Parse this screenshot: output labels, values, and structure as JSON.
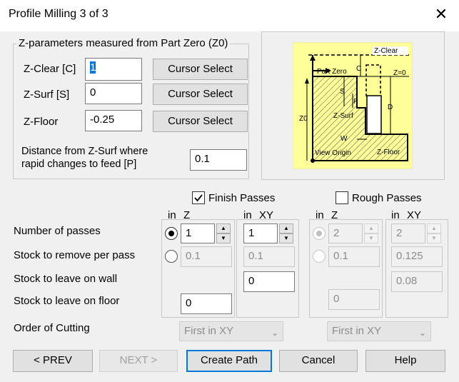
{
  "window": {
    "title": "Profile Milling 3 of 3",
    "close_glyph": "✕"
  },
  "zparams": {
    "group_label": "Z-parameters measured from Part Zero (Z0)",
    "zclear": {
      "label": "Z-Clear [C]",
      "value": "1"
    },
    "zsurf": {
      "label": "Z-Surf [S]",
      "value": "0"
    },
    "zfloor": {
      "label": "Z-Floor",
      "value": "-0.25"
    },
    "cursor_select_label": "Cursor Select",
    "distance": {
      "label_line1": "Distance from Z-Surf where",
      "label_line2": "rapid changes to feed [P]",
      "value": "0.1"
    }
  },
  "diagram": {
    "background": "#ffff99",
    "labels": {
      "zclear": "Z-Clear",
      "part_zero": "Part Zero",
      "c": "C",
      "z0eq": "Z=0",
      "s": "S",
      "p": "P",
      "d": "D",
      "z0": "Z0",
      "zsurf": "Z-Surf",
      "w": "W",
      "view_origin": "View Origin",
      "zfloor": "Z-Floor"
    }
  },
  "finish": {
    "checkbox_label": "Finish Passes",
    "checked": true,
    "col_z": {
      "unit": "in",
      "label": "Z"
    },
    "col_xy": {
      "unit": "in",
      "label": "XY"
    },
    "passes_z": "1",
    "passes_xy": "1",
    "stock_pass_z": "0.1",
    "stock_pass_xy": "0.1",
    "stock_wall": "0",
    "stock_floor": "0",
    "order": "First in XY"
  },
  "rough": {
    "checkbox_label": "Rough Passes",
    "checked": false,
    "col_z": {
      "unit": "in",
      "label": "Z"
    },
    "col_xy": {
      "unit": "in",
      "label": "XY"
    },
    "passes_z": "2",
    "passes_xy": "2",
    "stock_pass_z": "0.1",
    "stock_pass_xy": "0.125",
    "stock_wall": "0.08",
    "stock_floor": "0",
    "order": "First in XY"
  },
  "rows": {
    "number_of_passes": "Number of passes",
    "stock_per_pass": "Stock to remove per pass",
    "stock_wall": "Stock to leave on wall",
    "stock_floor": "Stock to leave on floor",
    "order_of_cutting": "Order of  Cutting"
  },
  "buttons": {
    "prev": "< PREV",
    "next": "NEXT >",
    "create_path": "Create Path",
    "cancel": "Cancel",
    "help": "Help"
  },
  "glyphs": {
    "up": "▲",
    "down": "▼",
    "dropdown": "⌄"
  }
}
